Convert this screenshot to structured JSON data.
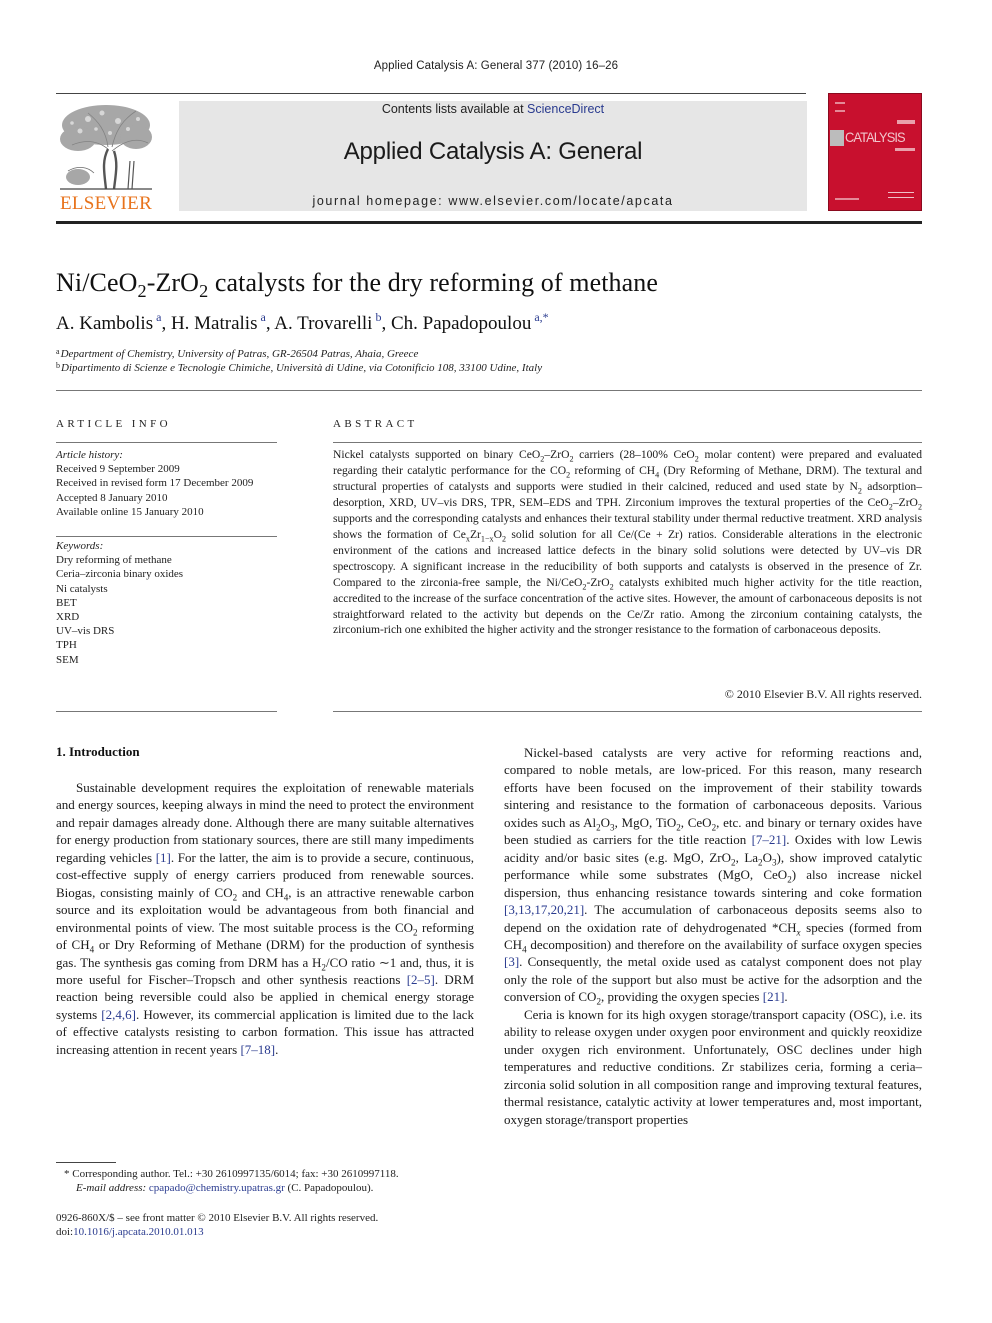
{
  "running_head": "Applied Catalysis A: General 377 (2010) 16–26",
  "masthead": {
    "publisher_logo_text": "ELSEVIER",
    "contents_prefix": "Contents lists available at ",
    "contents_link": "ScienceDirect",
    "journal_name": "Applied Catalysis A: General",
    "homepage_label": "journal homepage: ",
    "homepage_url": "www.elsevier.com/locate/apcata",
    "cover_title": "CATALYSIS",
    "colors": {
      "publisher_orange": "#e8731c",
      "cover_red": "#c8102e",
      "banner_grey": "#e6e6e6",
      "link_blue": "#2a3b8f"
    }
  },
  "article": {
    "title": [
      {
        "t": "Ni/CeO"
      },
      {
        "sub": "2"
      },
      {
        "t": "-ZrO"
      },
      {
        "sub": "2"
      },
      {
        "t": " catalysts for the dry reforming of methane"
      }
    ],
    "authors": [
      {
        "name": "A. Kambolis",
        "aff": "a"
      },
      {
        "name": "H. Matralis",
        "aff": "a"
      },
      {
        "name": "A. Trovarelli",
        "aff": "b"
      },
      {
        "name": "Ch. Papadopoulou",
        "aff": "a,*"
      }
    ],
    "affiliations": [
      {
        "mark": "a",
        "text": "Department of Chemistry, University of Patras, GR-26504 Patras, Ahaia, Greece"
      },
      {
        "mark": "b",
        "text": "Dipartimento di Scienze e Tecnologie Chimiche, Università di Udine, via Cotonificio 108, 33100 Udine, Italy"
      }
    ]
  },
  "article_info": {
    "label": "ARTICLE INFO",
    "history_heading": "Article history:",
    "history": [
      "Received 9 September 2009",
      "Received in revised form 17 December 2009",
      "Accepted 8 January 2010",
      "Available online 15 January 2010"
    ],
    "keywords_heading": "Keywords:",
    "keywords": [
      "Dry reforming of methane",
      "Ceria–zirconia binary oxides",
      "Ni catalysts",
      "BET",
      "XRD",
      "UV–vis DRS",
      "TPH",
      "SEM"
    ]
  },
  "abstract": {
    "label": "ABSTRACT",
    "segments": [
      {
        "t": "Nickel catalysts supported on binary CeO"
      },
      {
        "sub": "2"
      },
      {
        "t": "–ZrO"
      },
      {
        "sub": "2"
      },
      {
        "t": " carriers (28–100% CeO"
      },
      {
        "sub": "2"
      },
      {
        "t": " molar content) were prepared and evaluated regarding their catalytic performance for the CO"
      },
      {
        "sub": "2"
      },
      {
        "t": " reforming of CH"
      },
      {
        "sub": "4"
      },
      {
        "t": " (Dry Reforming of Methane, DRM). The textural and structural properties of catalysts and supports were studied in their calcined, reduced and used state by N"
      },
      {
        "sub": "2"
      },
      {
        "t": " adsorption–desorption, XRD, UV–vis DRS, TPR, SEM–EDS and TPH. Zirconium improves the textural properties of the CeO"
      },
      {
        "sub": "2"
      },
      {
        "t": "–ZrO"
      },
      {
        "sub": "2"
      },
      {
        "t": " supports and the corresponding catalysts and enhances their textural stability under thermal reductive treatment. XRD analysis shows the formation of Ce"
      },
      {
        "sub": "x"
      },
      {
        "t": "Zr"
      },
      {
        "sub": "1−x"
      },
      {
        "t": "O"
      },
      {
        "sub": "2"
      },
      {
        "t": " solid solution for all Ce/(Ce + Zr) ratios. Considerable alterations in the electronic environment of the cations and increased lattice defects in the binary solid solutions were detected by UV–vis DR spectroscopy. A significant increase in the reducibility of both supports and catalysts is observed in the presence of Zr. Compared to the zirconia-free sample, the Ni/CeO"
      },
      {
        "sub": "2"
      },
      {
        "t": "-ZrO"
      },
      {
        "sub": "2"
      },
      {
        "t": " catalysts exhibited much higher activity for the title reaction, accredited to the increase of the surface concentration of the active sites. However, the amount of carbonaceous deposits is not straightforward related to the activity but depends on the Ce/Zr ratio. Among the zirconium containing catalysts, the zirconium-rich one exhibited the higher activity and the stronger resistance to the formation of carbonaceous deposits."
      }
    ],
    "copyright": "© 2010 Elsevier B.V. All rights reserved."
  },
  "introduction": {
    "heading": "1.  Introduction",
    "left_column": [
      [
        {
          "t": "Sustainable development requires the exploitation of renewable materials and energy sources, keeping always in mind the need to protect the environment and repair damages already done. Although there are many suitable alternatives for energy production from stationary sources, there are still many impediments regarding vehicles "
        },
        {
          "ref": "[1]"
        },
        {
          "t": ". For the latter, the aim is to provide a secure, continuous, cost-effective supply of energy carriers produced from renewable sources. Biogas, consisting mainly of CO"
        },
        {
          "sub": "2"
        },
        {
          "t": " and CH"
        },
        {
          "sub": "4"
        },
        {
          "t": ", is an attractive renewable carbon source and its exploitation would be advantageous from both financial and environmental points of view. The most suitable process is the CO"
        },
        {
          "sub": "2"
        },
        {
          "t": " reforming of CH"
        },
        {
          "sub": "4"
        },
        {
          "t": " or Dry Reforming of Methane (DRM) for the production of synthesis gas. The synthesis gas coming from DRM has a H"
        },
        {
          "sub": "2"
        },
        {
          "t": "/CO ratio ∼1 and, thus, it is more useful for Fischer–Tropsch and other synthesis reactions "
        },
        {
          "ref": "[2–5]"
        },
        {
          "t": ". DRM reaction being reversible could also be applied in chemical energy storage systems "
        },
        {
          "ref": "[2,4,6]"
        },
        {
          "t": ". However, its commercial application is limited due to the lack of effective catalysts resisting to carbon formation. This issue has attracted increasing attention in recent years "
        },
        {
          "ref": "[7–18]"
        },
        {
          "t": "."
        }
      ]
    ],
    "right_column": [
      [
        {
          "t": "Nickel-based catalysts are very active for reforming reactions and, compared to noble metals, are low-priced. For this reason, many research efforts have been focused on the improvement of their stability towards sintering and resistance to the formation of carbonaceous deposits. Various oxides such as Al"
        },
        {
          "sub": "2"
        },
        {
          "t": "O"
        },
        {
          "sub": "3"
        },
        {
          "t": ", MgO, TiO"
        },
        {
          "sub": "2"
        },
        {
          "t": ", CeO"
        },
        {
          "sub": "2"
        },
        {
          "t": ", etc. and binary or ternary oxides have been studied as carriers for the title reaction "
        },
        {
          "ref": "[7–21]"
        },
        {
          "t": ". Oxides with low Lewis acidity and/or basic sites (e.g. MgO, ZrO"
        },
        {
          "sub": "2"
        },
        {
          "t": ", La"
        },
        {
          "sub": "2"
        },
        {
          "t": "O"
        },
        {
          "sub": "3"
        },
        {
          "t": "), show improved catalytic performance while some substrates (MgO, CeO"
        },
        {
          "sub": "2"
        },
        {
          "t": ") also increase nickel dispersion, thus enhancing resistance towards sintering and coke formation "
        },
        {
          "ref": "[3,13,17,20,21]"
        },
        {
          "t": ". The accumulation of carbonaceous deposits seems also to depend on the oxidation rate of dehydrogenated *CH"
        },
        {
          "sub_i": "x"
        },
        {
          "t": " species (formed from CH"
        },
        {
          "sub": "4"
        },
        {
          "t": " decomposition) and therefore on the availability of surface oxygen species "
        },
        {
          "ref": "[3]"
        },
        {
          "t": ". Consequently, the metal oxide used as catalyst component does not play only the role of the support but also must be active for the adsorption and the conversion of CO"
        },
        {
          "sub": "2"
        },
        {
          "t": ", providing the oxygen species "
        },
        {
          "ref": "[21]"
        },
        {
          "t": "."
        }
      ],
      [
        {
          "t": "Ceria is known for its high oxygen storage/transport capacity (OSC), i.e. its ability to release oxygen under oxygen poor environment and quickly reoxidize under oxygen rich environment. Unfortunately, OSC declines under high temperatures and reductive conditions. Zr stabilizes ceria, forming a ceria–zirconia solid solution in all composition range and improving textural features, thermal resistance, catalytic activity at lower temperatures and, most important, oxygen storage/transport properties"
        }
      ]
    ]
  },
  "footnotes": {
    "corresponding": "* Corresponding author. Tel.: +30 2610997135/6014; fax: +30 2610997118.",
    "email_label": "E-mail address: ",
    "email": "cpapado@chemistry.upatras.gr",
    "email_suffix": " (C. Papadopoulou).",
    "issn_line": "0926-860X/$ – see front matter © 2010 Elsevier B.V. All rights reserved.",
    "doi_prefix": "doi:",
    "doi": "10.1016/j.apcata.2010.01.013"
  }
}
